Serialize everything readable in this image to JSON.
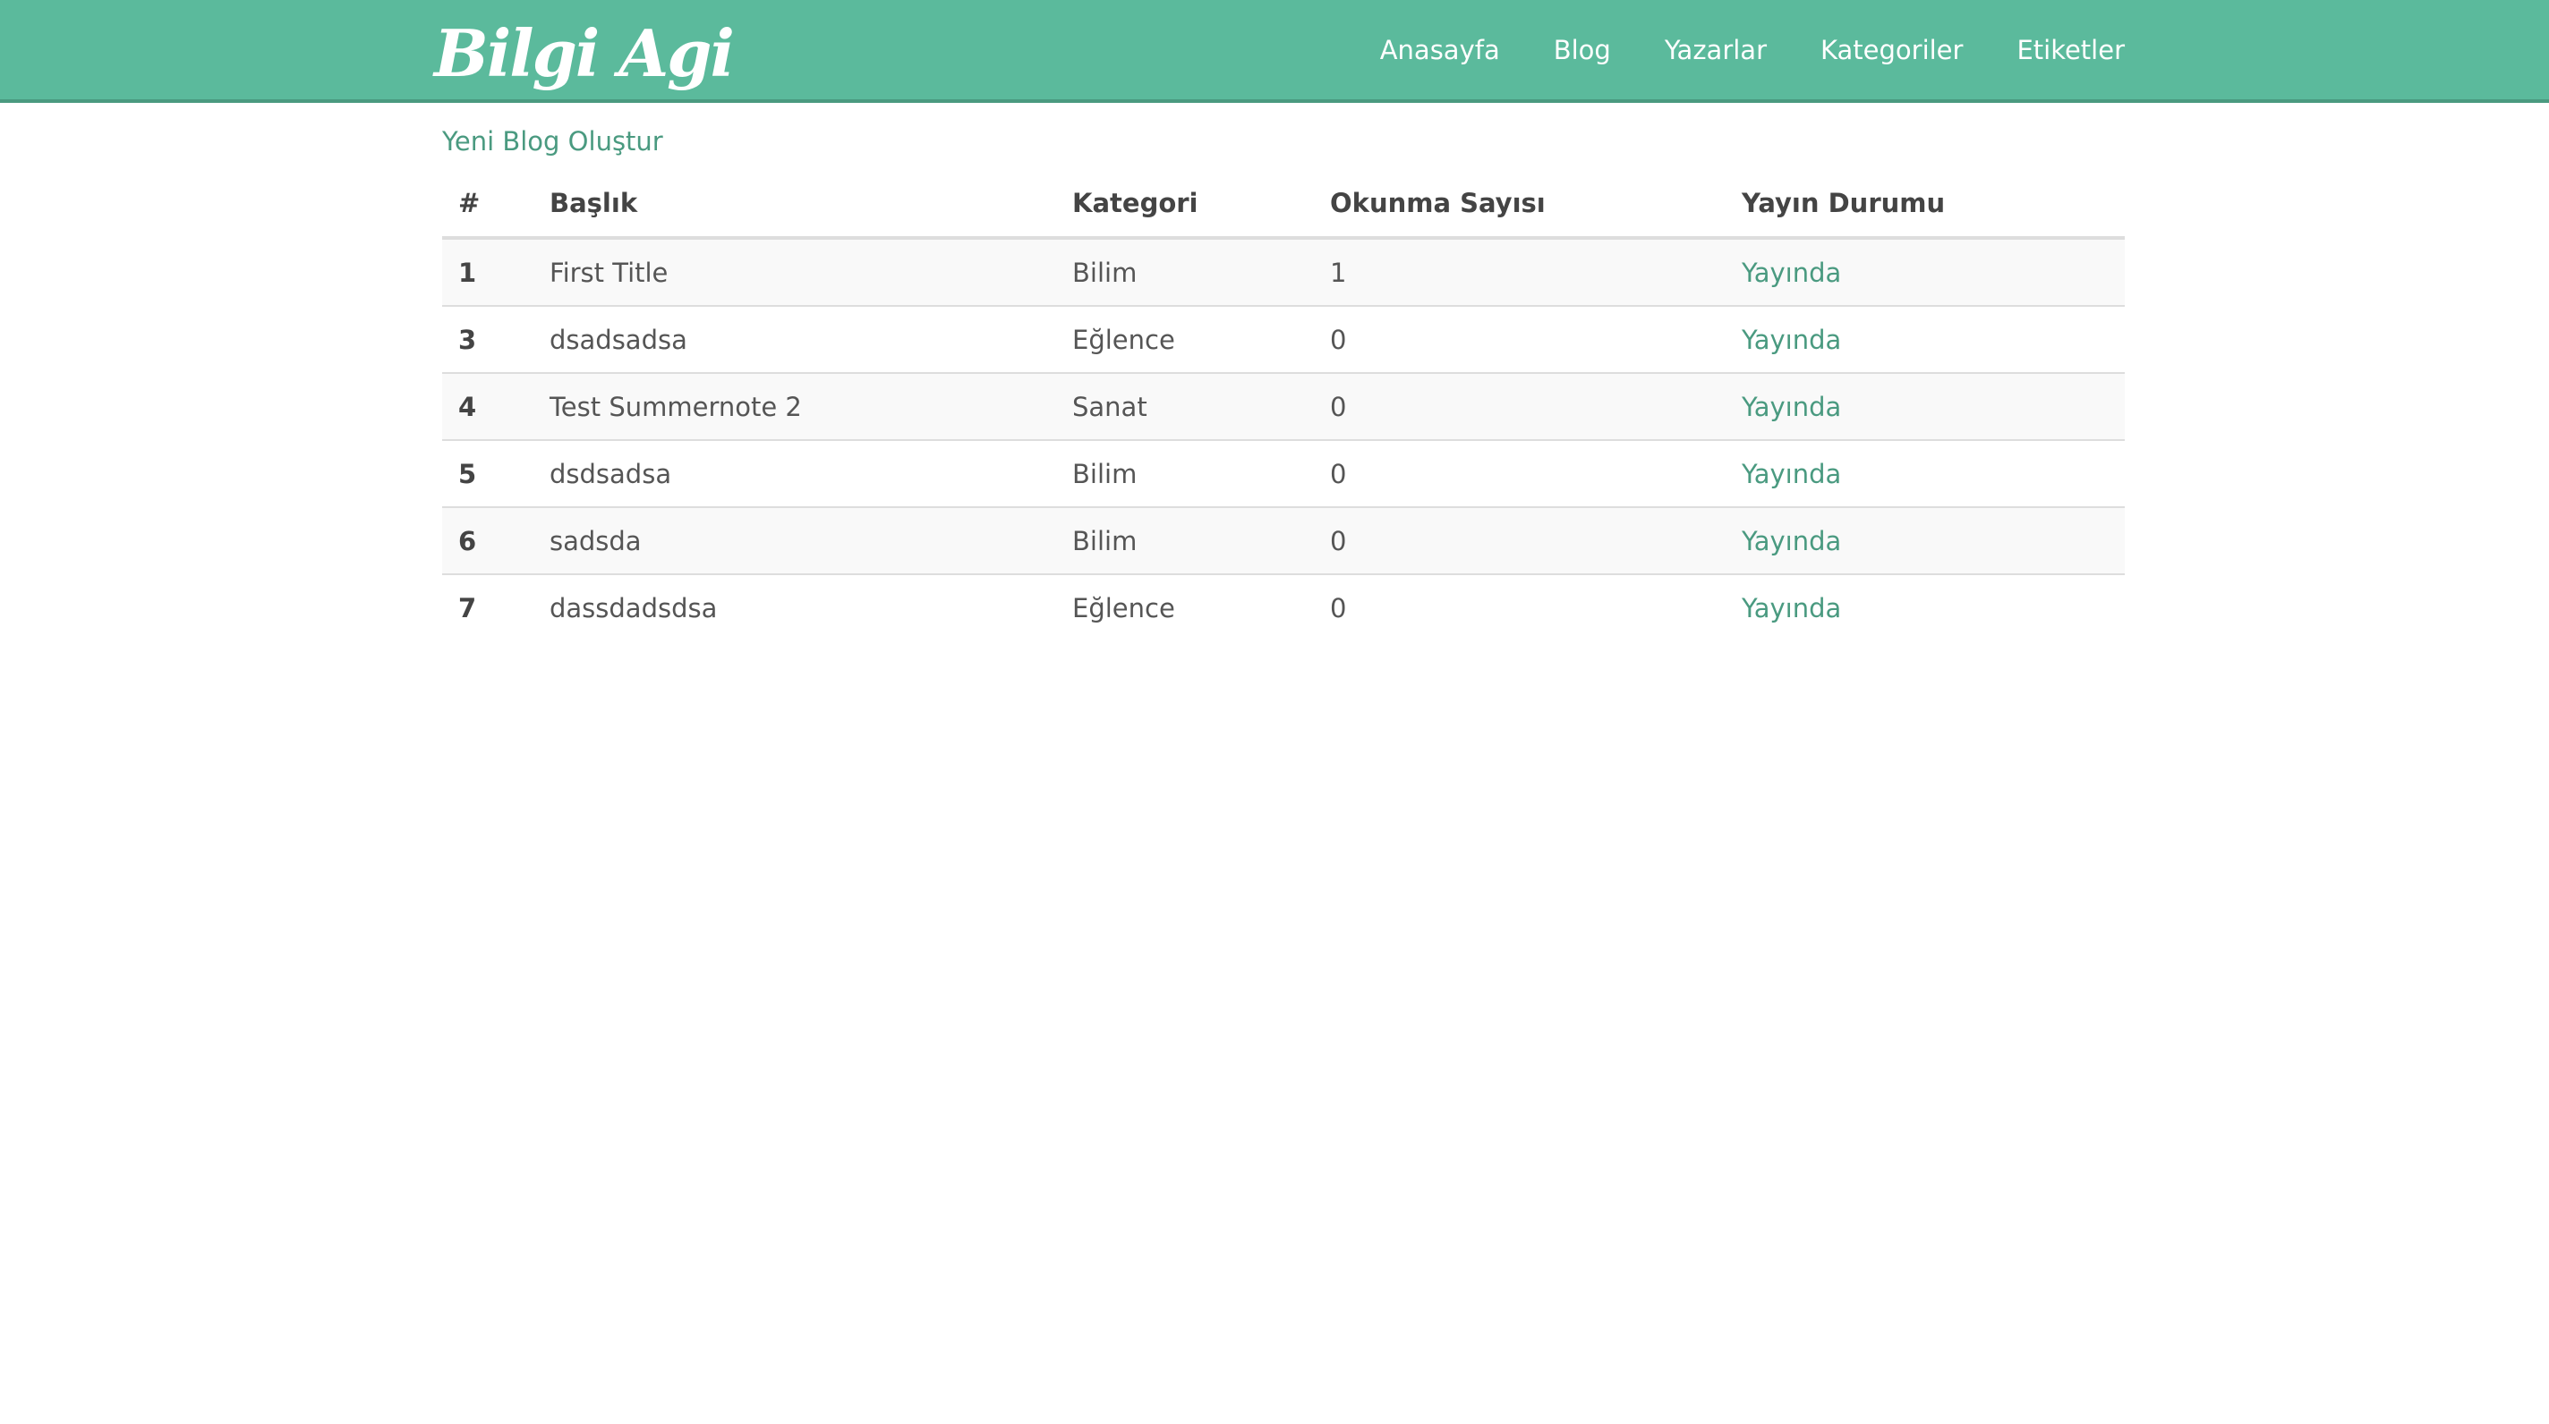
{
  "brand": {
    "name": "Bilgi Agi"
  },
  "nav": {
    "items": [
      {
        "label": "Anasayfa"
      },
      {
        "label": "Blog"
      },
      {
        "label": "Yazarlar"
      },
      {
        "label": "Kategoriler"
      },
      {
        "label": "Etiketler"
      }
    ]
  },
  "actions": {
    "new_blog_label": "Yeni Blog Oluştur"
  },
  "table": {
    "headers": [
      "#",
      "Başlık",
      "Kategori",
      "Okunma Sayısı",
      "Yayın Durumu"
    ],
    "rows": [
      {
        "id": "1",
        "title": "First Title",
        "category": "Bilim",
        "reads": "1",
        "status": "Yayında"
      },
      {
        "id": "3",
        "title": "dsadsadsa",
        "category": "Eğlence",
        "reads": "0",
        "status": "Yayında"
      },
      {
        "id": "4",
        "title": "Test Summernote 2",
        "category": "Sanat",
        "reads": "0",
        "status": "Yayında"
      },
      {
        "id": "5",
        "title": "dsdsadsa",
        "category": "Bilim",
        "reads": "0",
        "status": "Yayında"
      },
      {
        "id": "6",
        "title": "sadsda",
        "category": "Bilim",
        "reads": "0",
        "status": "Yayında"
      },
      {
        "id": "7",
        "title": "dassdadsdsa",
        "category": "Eğlence",
        "reads": "0",
        "status": "Yayında"
      }
    ]
  },
  "colors": {
    "navbar": "#5bba9c",
    "accent": "#4a9a80",
    "text": "#555555"
  }
}
